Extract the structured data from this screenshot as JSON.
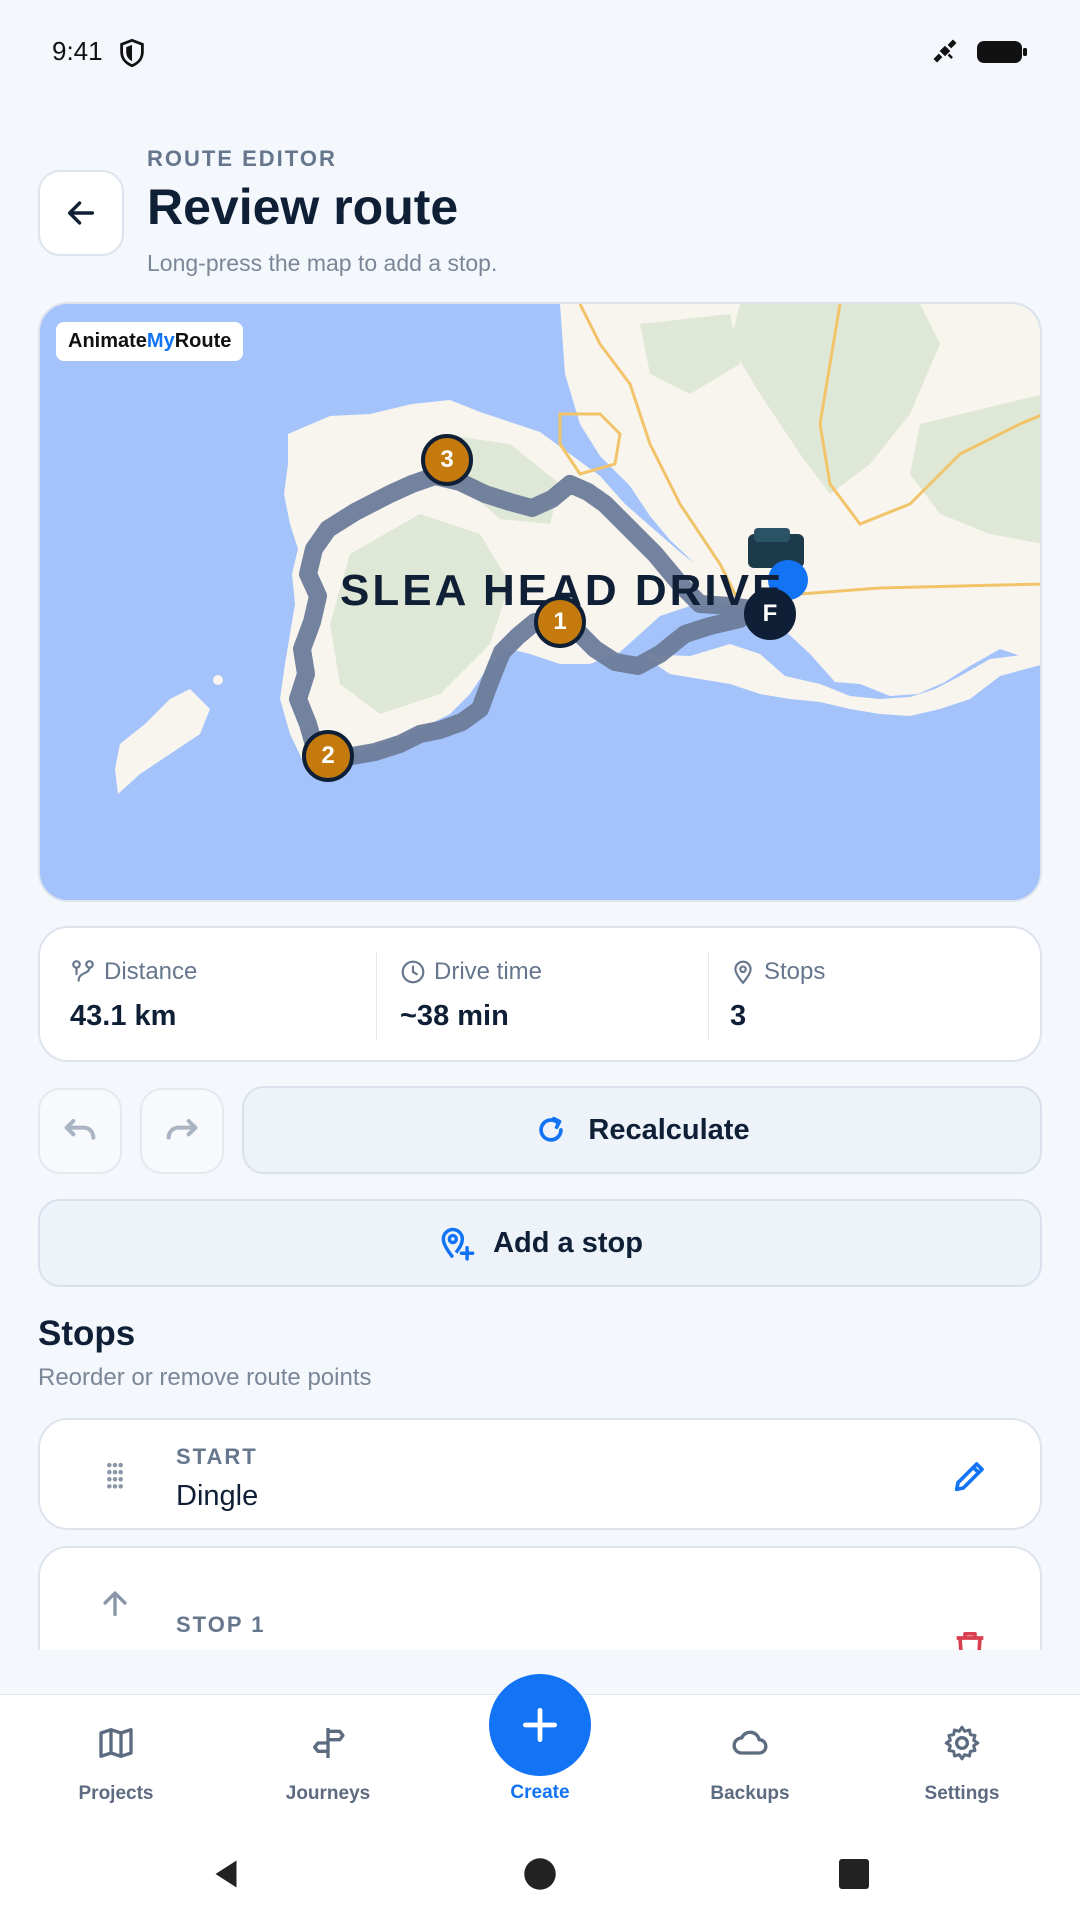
{
  "status": {
    "time": "9:41",
    "icons": [
      "shield-icon",
      "satellite-icon",
      "battery-icon"
    ]
  },
  "header": {
    "eyebrow": "ROUTE EDITOR",
    "title": "Review route",
    "subtitle": "Long-press the map to add a stop."
  },
  "map": {
    "brand_prefix": "Animate",
    "brand_accent": "My",
    "brand_suffix": "Route",
    "region_label": "SLEA HEAD DRIVE",
    "markers": [
      {
        "label": "1"
      },
      {
        "label": "2"
      },
      {
        "label": "3"
      },
      {
        "label": "F"
      }
    ],
    "colors": {
      "water": "#a5c3fb",
      "land": "#f8f5ee",
      "route": "#6c7c9a",
      "marker": "#c47a0d",
      "finish": "#0f1f36"
    }
  },
  "stats": {
    "distance_label": "Distance",
    "distance_value": "43.1 km",
    "drive_label": "Drive time",
    "drive_value": "~38 min",
    "stops_label": "Stops",
    "stops_value": "3"
  },
  "actions": {
    "recalculate": "Recalculate",
    "add_stop": "Add a stop"
  },
  "stops_section": {
    "title": "Stops",
    "subtitle": "Reorder or remove route points",
    "items": [
      {
        "type": "START",
        "name": "Dingle"
      },
      {
        "type": "STOP 1",
        "name": ""
      }
    ]
  },
  "nav": {
    "items": [
      "Projects",
      "Journeys",
      "Create",
      "Backups",
      "Settings"
    ],
    "active": "Create"
  },
  "theme": {
    "accent": "#1273f5",
    "danger": "#d9404f",
    "text": "#0f1f36",
    "muted": "#66768c"
  }
}
